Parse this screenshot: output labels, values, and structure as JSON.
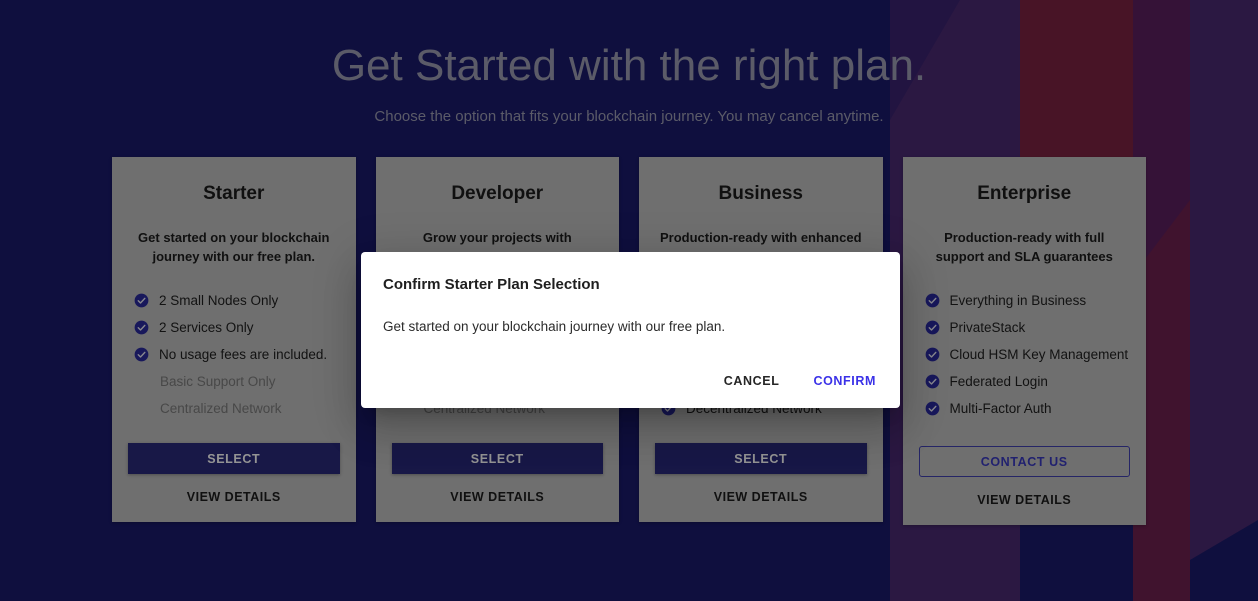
{
  "colors": {
    "page_background": "#1a1a6b",
    "band_purple": "#4a2a72",
    "band_crimson": "#7d2442",
    "band_magenta": "#6e2150",
    "accent_indigo": "#2a2a7a",
    "confirm_blue": "#3b32e8",
    "card_surface": "#bfbfbf"
  },
  "header": {
    "title": "Get Started with the right plan.",
    "subtitle": "Choose the option that fits your blockchain journey. You may cancel anytime."
  },
  "plans": [
    {
      "id": "starter",
      "name": "Starter",
      "description": "Get started on your blockchain journey with our free plan.",
      "features": [
        {
          "label": "2 Small Nodes Only",
          "included": true
        },
        {
          "label": "2 Services Only",
          "included": true
        },
        {
          "label": "No usage fees are included.",
          "included": true
        },
        {
          "label": "Basic Support Only",
          "included": false
        },
        {
          "label": "Centralized Network",
          "included": false
        }
      ],
      "cta": "SELECT",
      "cta_style": "filled",
      "details_label": "VIEW DETAILS"
    },
    {
      "id": "developer",
      "name": "Developer",
      "description": "Grow your projects with",
      "features": [
        {
          "label": "",
          "included": true
        },
        {
          "label": "",
          "included": true
        },
        {
          "label": "",
          "included": true
        },
        {
          "label": "",
          "included": false
        },
        {
          "label": "Centralized Network",
          "included": false
        }
      ],
      "cta": "SELECT",
      "cta_style": "filled",
      "details_label": "VIEW DETAILS"
    },
    {
      "id": "business",
      "name": "Business",
      "description": "Production-ready with enhanced",
      "features": [
        {
          "label": "",
          "included": true
        },
        {
          "label": "",
          "included": true
        },
        {
          "label": "",
          "included": true
        },
        {
          "label": "",
          "included": true
        },
        {
          "label": "Decentralized Network",
          "included": true
        }
      ],
      "cta": "SELECT",
      "cta_style": "filled",
      "details_label": "VIEW DETAILS"
    },
    {
      "id": "enterprise",
      "name": "Enterprise",
      "description": "Production-ready with full support and SLA guarantees",
      "features": [
        {
          "label": "Everything in Business",
          "included": true
        },
        {
          "label": "PrivateStack",
          "included": true
        },
        {
          "label": "Cloud HSM Key Management",
          "included": true
        },
        {
          "label": "Federated Login",
          "included": true
        },
        {
          "label": "Multi-Factor Auth",
          "included": true
        }
      ],
      "cta": "CONTACT US",
      "cta_style": "outline",
      "details_label": "VIEW DETAILS"
    }
  ],
  "modal": {
    "title": "Confirm Starter Plan Selection",
    "body": "Get started on your blockchain journey with our free plan.",
    "cancel_label": "CANCEL",
    "confirm_label": "CONFIRM"
  }
}
